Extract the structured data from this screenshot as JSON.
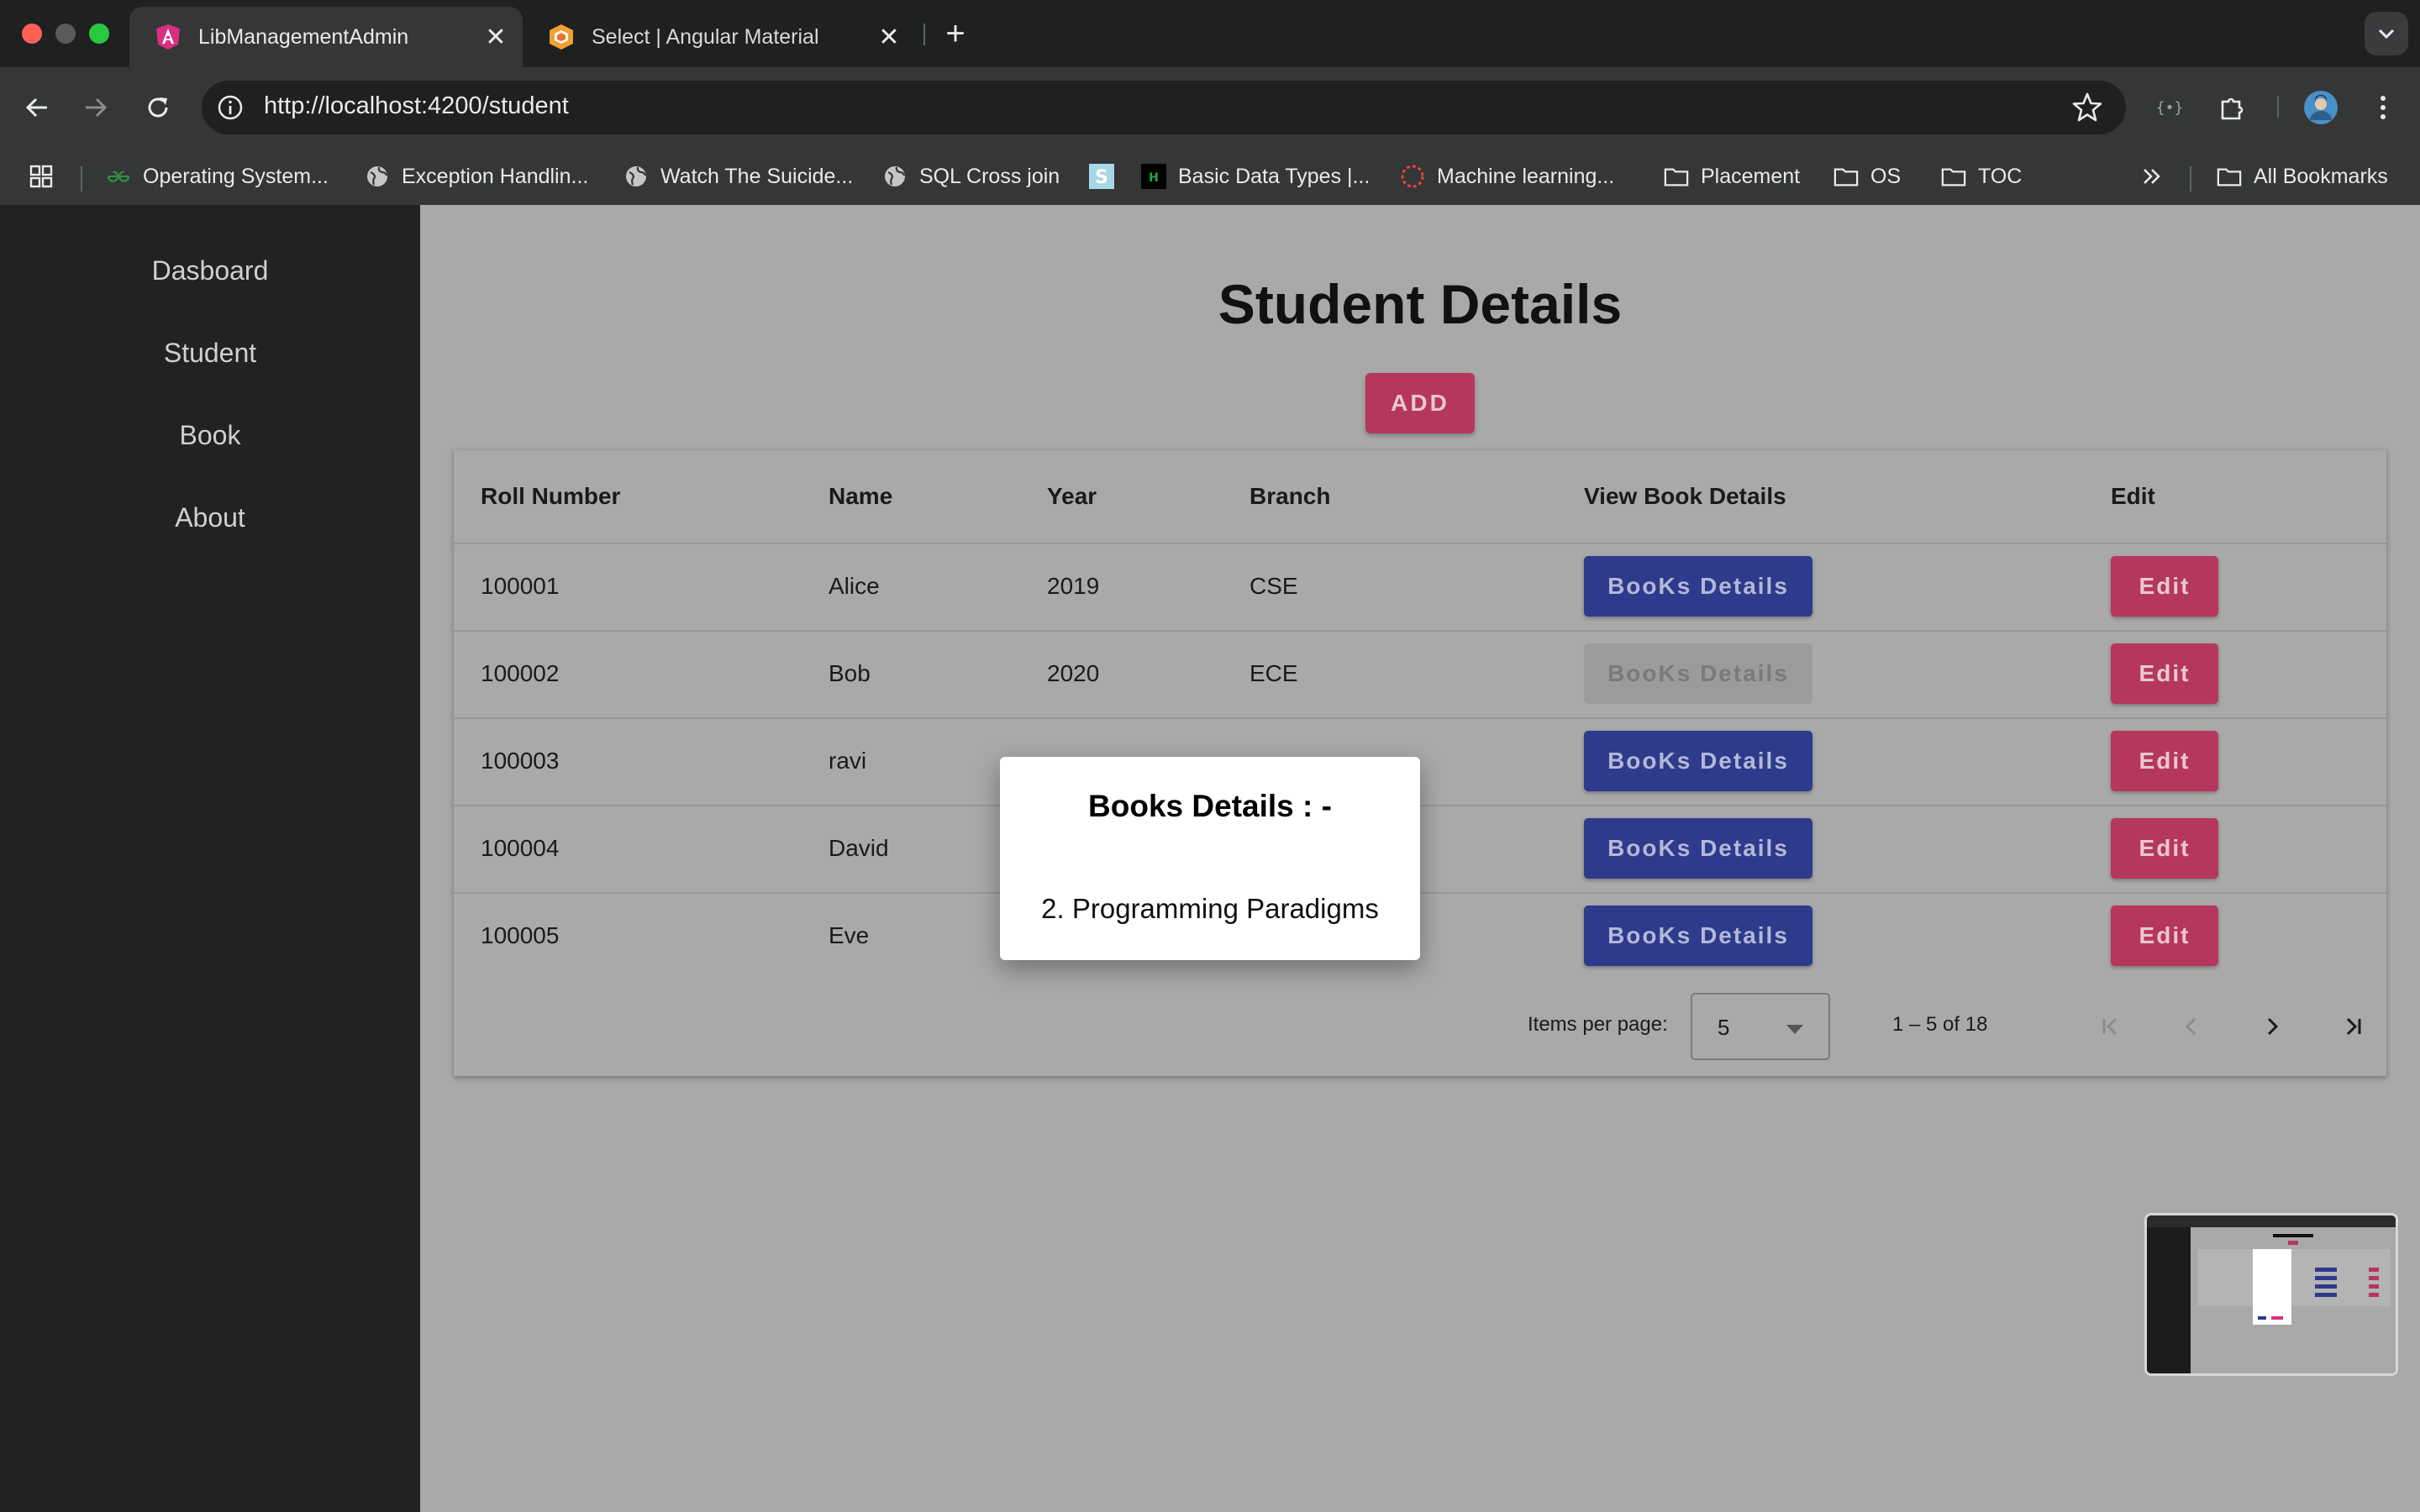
{
  "browser": {
    "tabs": [
      {
        "title": "LibManagementAdmin",
        "active": true,
        "icon": "angular-icon"
      },
      {
        "title": "Select | Angular Material",
        "active": false,
        "icon": "angular-material-icon"
      }
    ],
    "url": "http://localhost:4200/student",
    "bookmarks": [
      {
        "label": "Operating System...",
        "icon": "geeksforgeeks-icon"
      },
      {
        "label": "Exception Handlin...",
        "icon": "globe-icon"
      },
      {
        "label": "Watch The Suicide...",
        "icon": "globe-icon"
      },
      {
        "label": "SQL Cross join",
        "icon": "globe-icon"
      },
      {
        "label": "",
        "icon": "s-square-icon"
      },
      {
        "label": "Basic Data Types |...",
        "icon": "hackerrank-icon"
      },
      {
        "label": "Machine learning...",
        "icon": "dotted-circle-icon"
      },
      {
        "label": "Placement",
        "icon": "folder-icon"
      },
      {
        "label": "OS",
        "icon": "folder-icon"
      },
      {
        "label": "TOC",
        "icon": "folder-icon"
      }
    ],
    "all_bookmarks": "All Bookmarks"
  },
  "sidebar": {
    "items": [
      {
        "label": "Dasboard"
      },
      {
        "label": "Student"
      },
      {
        "label": "Book"
      },
      {
        "label": "About"
      }
    ]
  },
  "main": {
    "title": "Student Details",
    "add_label": "ADD"
  },
  "table": {
    "headers": [
      "Roll Number",
      "Name",
      "Year",
      "Branch",
      "View Book Details",
      "Edit"
    ],
    "rows": [
      {
        "roll": "100001",
        "name": "Alice",
        "year": "2019",
        "branch": "CSE",
        "books_label": "BooKs Details",
        "books_disabled": false,
        "edit_label": "Edit"
      },
      {
        "roll": "100002",
        "name": "Bob",
        "year": "2020",
        "branch": "ECE",
        "books_label": "BooKs Details",
        "books_disabled": true,
        "edit_label": "Edit"
      },
      {
        "roll": "100003",
        "name": "ravi",
        "year": "",
        "branch": "",
        "books_label": "BooKs Details",
        "books_disabled": false,
        "edit_label": "Edit"
      },
      {
        "roll": "100004",
        "name": "David",
        "year": "",
        "branch": "",
        "books_label": "BooKs Details",
        "books_disabled": false,
        "edit_label": "Edit"
      },
      {
        "roll": "100005",
        "name": "Eve",
        "year": "",
        "branch": "",
        "books_label": "BooKs Details",
        "books_disabled": false,
        "edit_label": "Edit"
      }
    ]
  },
  "paginator": {
    "items_per_page_label": "Items per page:",
    "page_size": "5",
    "range_label": "1 – 5 of 18"
  },
  "dialog": {
    "title": "Books Details : -",
    "items": [
      "2. Programming Paradigms"
    ]
  },
  "colors": {
    "primary": "#2e3a8c",
    "accent": "#b5375e",
    "sidebar": "#222222",
    "backdrop": "#a9a9a9"
  }
}
